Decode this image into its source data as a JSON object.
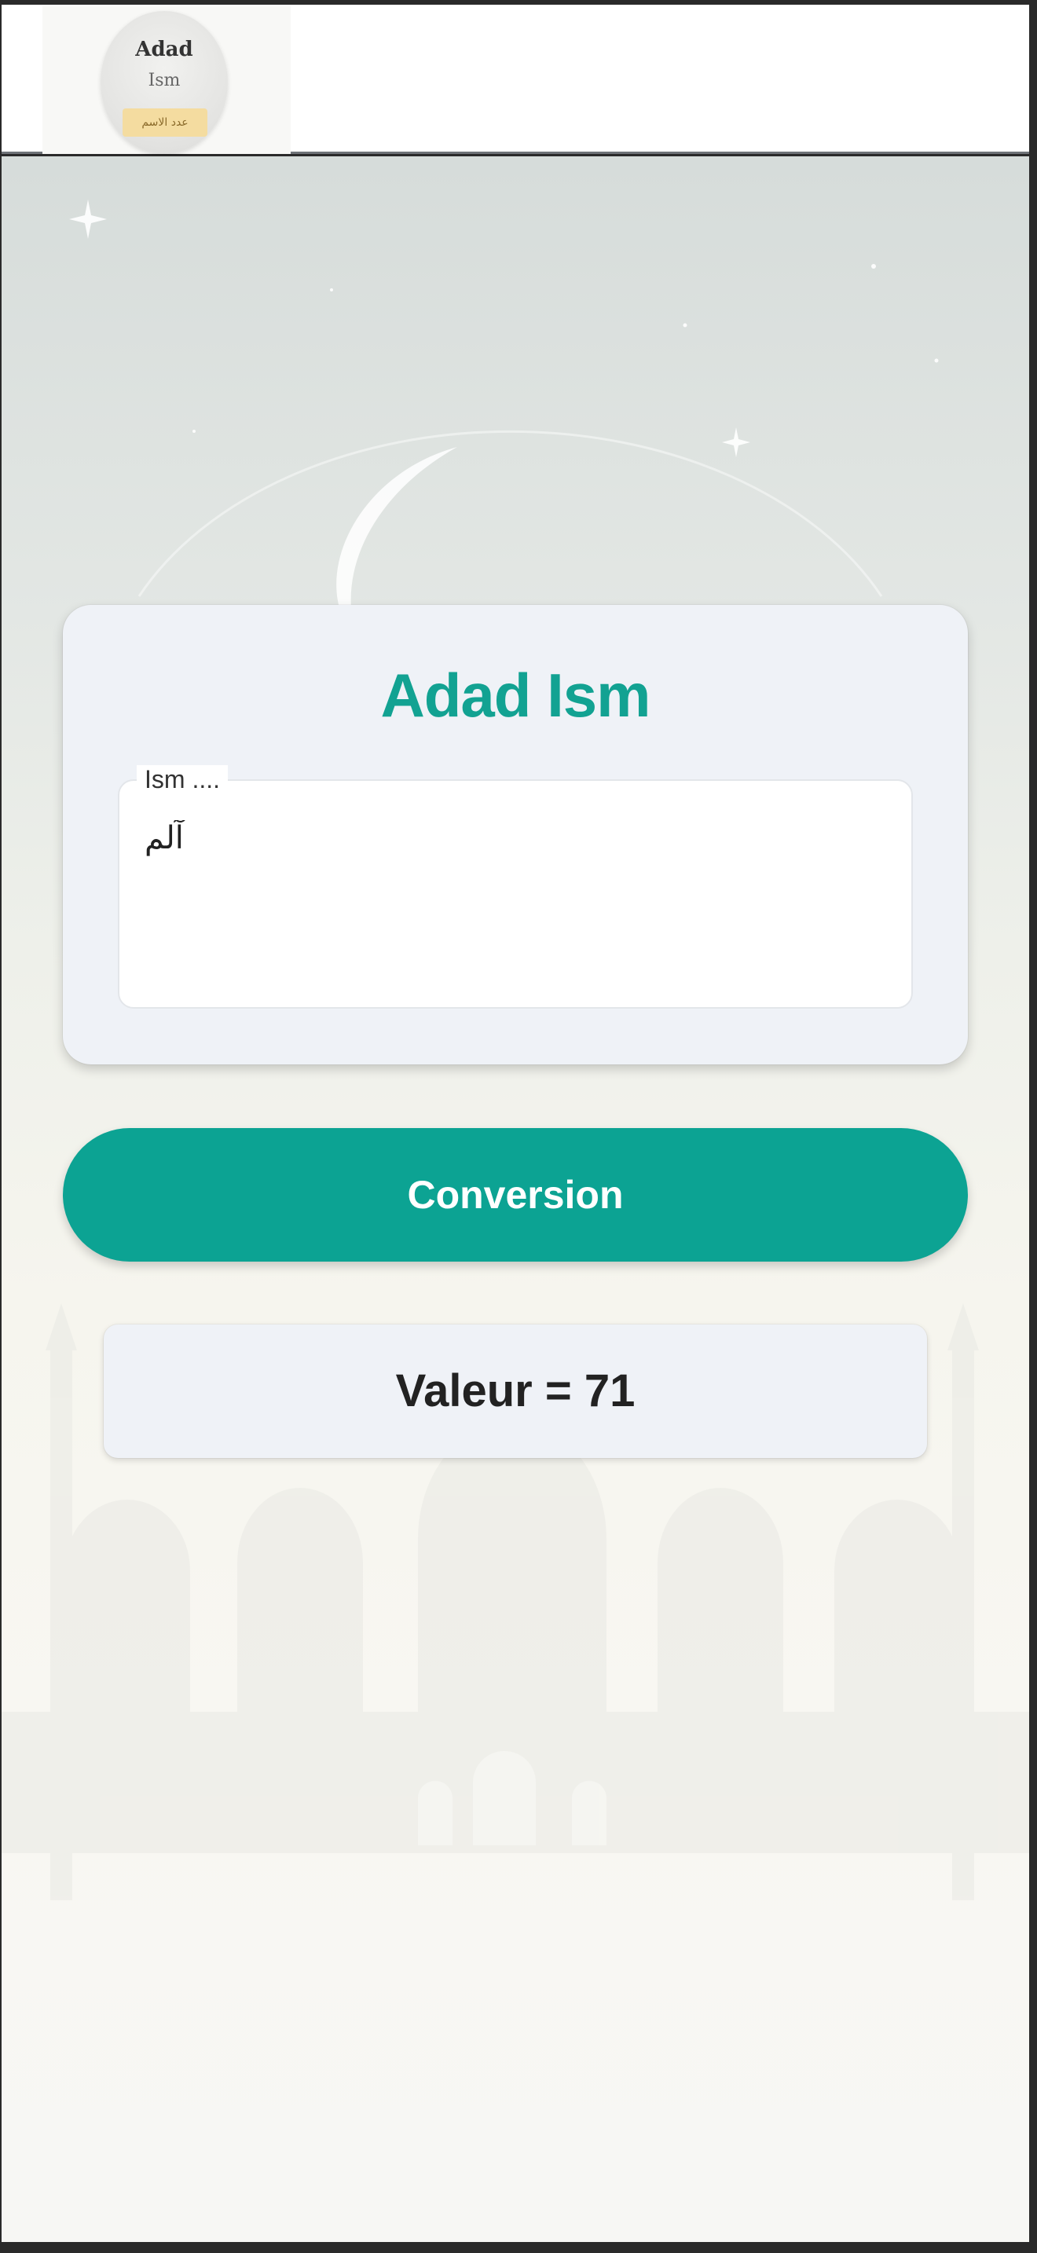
{
  "header": {
    "logo_title": "Adad",
    "logo_subtitle": "Ism",
    "logo_banner": "عدد الاسم"
  },
  "card": {
    "title": "Adad Ism",
    "input_label": "Ism ....",
    "input_value": "آلم"
  },
  "button": {
    "label": "Conversion"
  },
  "result": {
    "text": "Valeur = 71"
  },
  "colors": {
    "accent": "#0ca393",
    "title": "#12a292",
    "card_background": "#eff2f7"
  }
}
